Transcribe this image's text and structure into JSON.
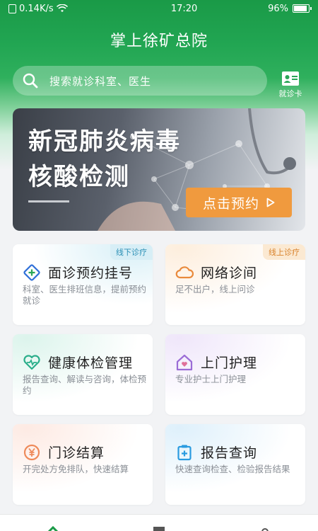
{
  "status_bar": {
    "network_speed": "0.14K/s",
    "time": "17:20",
    "battery": "96%",
    "battery_level": 0.96
  },
  "header": {
    "title": "掌上徐矿总院"
  },
  "search": {
    "placeholder": "搜索就诊科室、医生"
  },
  "medical_card": {
    "label": "就诊卡"
  },
  "banner": {
    "title_line1": "新冠肺炎病毒",
    "title_line2": "核酸检测",
    "cta_label": "点击预约"
  },
  "services": [
    {
      "title": "面诊预约挂号",
      "desc": "科室、医生排班信息，提前预约就诊",
      "tag": "线下诊疗",
      "icon": "diamond-plus-icon",
      "color": "#2e6fd8"
    },
    {
      "title": "网络诊间",
      "desc": "足不出户，线上问诊",
      "tag": "线上诊疗",
      "icon": "cloud-icon",
      "color": "#e98a3c"
    },
    {
      "title": "健康体检管理",
      "desc": "报告查询、解读与咨询，体检预约",
      "tag": "",
      "icon": "heart-pulse-icon",
      "color": "#2aae8a"
    },
    {
      "title": "上门护理",
      "desc": "专业护士上门护理",
      "tag": "",
      "icon": "home-heart-icon",
      "color": "#9b6cd6"
    },
    {
      "title": "门诊结算",
      "desc": "开完处方免排队，快速结算",
      "tag": "",
      "icon": "yen-icon",
      "color": "#ee8a5a"
    },
    {
      "title": "报告查询",
      "desc": "快速查询检查、检验报告结果",
      "tag": "",
      "icon": "clipboard-plus-icon",
      "color": "#2a9be0"
    }
  ],
  "colors": {
    "brand_green": "#1a9a47",
    "cta_orange": "#f09a3e",
    "tag_offline_bg": "#d7eef6",
    "tag_offline_text": "#2a8fb5",
    "tag_online_bg": "#fbe9d2",
    "tag_online_text": "#d9822b"
  }
}
